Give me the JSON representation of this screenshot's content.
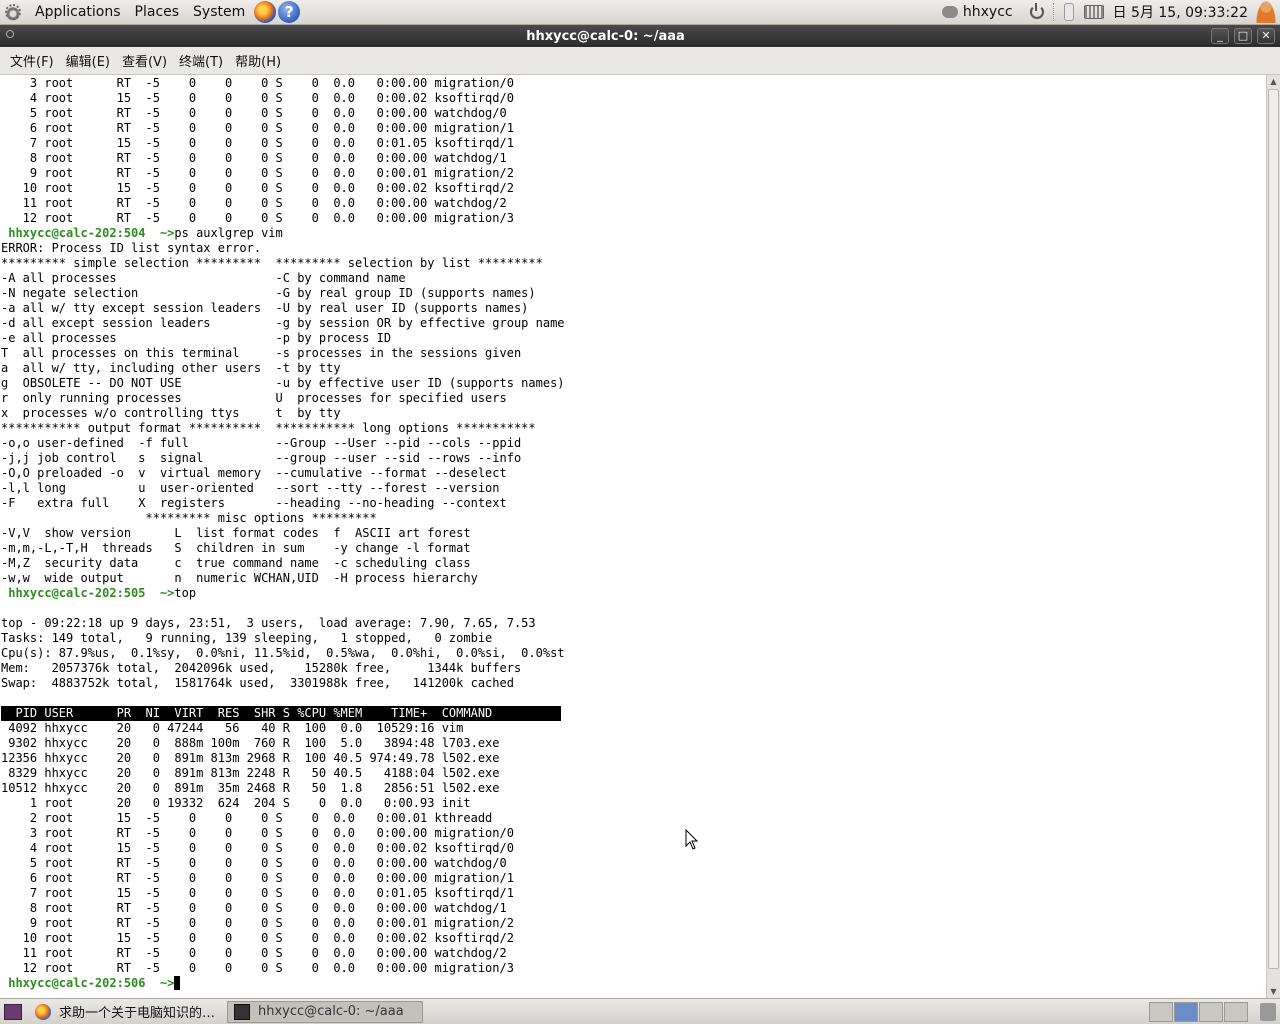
{
  "top_panel": {
    "menus": [
      "Applications",
      "Places",
      "System"
    ],
    "username": "hhxycc",
    "clock": "日 5月 15, 09:33:22"
  },
  "window": {
    "title": "hhxycc@calc-0: ~/aaa",
    "menu": [
      "文件(F)",
      "编辑(E)",
      "查看(V)",
      "终端(T)",
      "帮助(H)"
    ]
  },
  "terminal": {
    "lines": [
      "    3 root      RT  -5    0    0    0 S    0  0.0   0:00.00 migration/0",
      "    4 root      15  -5    0    0    0 S    0  0.0   0:00.02 ksoftirqd/0",
      "    5 root      RT  -5    0    0    0 S    0  0.0   0:00.00 watchdog/0",
      "    6 root      RT  -5    0    0    0 S    0  0.0   0:00.00 migration/1",
      "    7 root      15  -5    0    0    0 S    0  0.0   0:01.05 ksoftirqd/1",
      "    8 root      RT  -5    0    0    0 S    0  0.0   0:00.00 watchdog/1",
      "    9 root      RT  -5    0    0    0 S    0  0.0   0:00.01 migration/2",
      "   10 root      15  -5    0    0    0 S    0  0.0   0:00.02 ksoftirqd/2",
      "   11 root      RT  -5    0    0    0 S    0  0.0   0:00.00 watchdog/2",
      "   12 root      RT  -5    0    0    0 S    0  0.0   0:00.00 migration/3",
      {
        "prompt": " hhxycc@calc-202:504  ~>",
        "cmd": "ps auxlgrep vim"
      },
      "ERROR: Process ID list syntax error.",
      "********* simple selection *********  ********* selection by list *********",
      "-A all processes                      -C by command name",
      "-N negate selection                   -G by real group ID (supports names)",
      "-a all w/ tty except session leaders  -U by real user ID (supports names)",
      "-d all except session leaders         -g by session OR by effective group name",
      "-e all processes                      -p by process ID",
      "T  all processes on this terminal     -s processes in the sessions given",
      "a  all w/ tty, including other users  -t by tty",
      "g  OBSOLETE -- DO NOT USE             -u by effective user ID (supports names)",
      "r  only running processes             U  processes for specified users",
      "x  processes w/o controlling ttys     t  by tty",
      "*********** output format **********  *********** long options ***********",
      "-o,o user-defined  -f full            --Group --User --pid --cols --ppid",
      "-j,j job control   s  signal          --group --user --sid --rows --info",
      "-O,O preloaded -o  v  virtual memory  --cumulative --format --deselect",
      "-l,l long          u  user-oriented   --sort --tty --forest --version",
      "-F   extra full    X  registers       --heading --no-heading --context",
      "                    ********* misc options *********",
      "-V,V  show version      L  list format codes  f  ASCII art forest",
      "-m,m,-L,-T,H  threads   S  children in sum    -y change -l format",
      "-M,Z  security data     c  true command name  -c scheduling class",
      "-w,w  wide output       n  numeric WCHAN,UID  -H process hierarchy",
      {
        "prompt": " hhxycc@calc-202:505  ~>",
        "cmd": "top"
      },
      "",
      "top - 09:22:18 up 9 days, 23:51,  3 users,  load average: 7.90, 7.65, 7.53",
      "Tasks: 149 total,   9 running, 139 sleeping,   1 stopped,   0 zombie",
      "Cpu(s): 87.9%us,  0.1%sy,  0.0%ni, 11.5%id,  0.5%wa,  0.0%hi,  0.0%si,  0.0%st",
      "Mem:   2057376k total,  2042096k used,    15280k free,     1344k buffers",
      "Swap:  4883752k total,  1581764k used,  3301988k free,   141200k cached",
      "",
      {
        "header": "  PID USER      PR  NI  VIRT  RES  SHR S %CPU %MEM    TIME+  COMMAND"
      },
      " 4092 hhxycc    20   0 47244   56   40 R  100  0.0  10529:16 vim",
      " 9302 hhxycc    20   0  888m 100m  760 R  100  5.0   3894:48 l703.exe",
      "12356 hhxycc    20   0  891m 813m 2968 R  100 40.5 974:49.78 l502.exe",
      " 8329 hhxycc    20   0  891m 813m 2248 R   50 40.5   4188:04 l502.exe",
      "10512 hhxycc    20   0  891m  35m 2468 R   50  1.8   2856:51 l502.exe",
      "    1 root      20   0 19332  624  204 S    0  0.0   0:00.93 init",
      "    2 root      15  -5    0    0    0 S    0  0.0   0:00.01 kthreadd",
      "    3 root      RT  -5    0    0    0 S    0  0.0   0:00.00 migration/0",
      "    4 root      15  -5    0    0    0 S    0  0.0   0:00.02 ksoftirqd/0",
      "    5 root      RT  -5    0    0    0 S    0  0.0   0:00.00 watchdog/0",
      "    6 root      RT  -5    0    0    0 S    0  0.0   0:00.00 migration/1",
      "    7 root      15  -5    0    0    0 S    0  0.0   0:01.05 ksoftirqd/1",
      "    8 root      RT  -5    0    0    0 S    0  0.0   0:00.00 watchdog/1",
      "    9 root      RT  -5    0    0    0 S    0  0.0   0:00.01 migration/2",
      "   10 root      15  -5    0    0    0 S    0  0.0   0:00.02 ksoftirqd/2",
      "   11 root      RT  -5    0    0    0 S    0  0.0   0:00.00 watchdog/2",
      "   12 root      RT  -5    0    0    0 S    0  0.0   0:00.00 migration/3",
      {
        "prompt": " hhxycc@calc-202:506  ~>",
        "cmd": "",
        "cursor": true
      }
    ]
  },
  "taskbar": {
    "tasks": [
      "求助一个关于电脑知识的…",
      "hhxycc@calc-0: ~/aaa"
    ]
  },
  "colors": {
    "prompt": "#2e8b22",
    "title_bar": "#2b2b2b",
    "terminal_bg": "#ffffff"
  }
}
